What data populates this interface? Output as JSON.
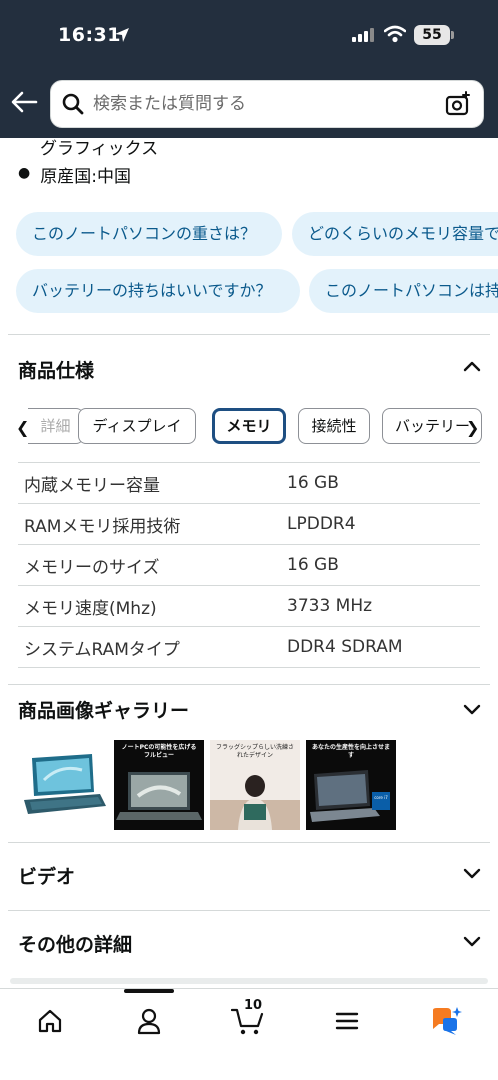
{
  "status_bar": {
    "time": "16:31",
    "battery": "55"
  },
  "search": {
    "placeholder": "検索または質問する"
  },
  "details_tail": {
    "continuation": "グラフィックス",
    "bullet": "原産国:中国"
  },
  "question_chips": [
    "このノートパソコンの重さは？",
    "どのくらいのメモリ容量で",
    "バッテリーの持ちはいいですか？",
    "このノートパソコンは持"
  ],
  "specs": {
    "title": "商品仕様",
    "tabs": [
      "詳細",
      "ディスプレイ",
      "メモリ",
      "接続性",
      "バッテリー"
    ],
    "active_tab": "メモリ",
    "rows": [
      {
        "key": "内蔵メモリー容量",
        "value": "16 GB"
      },
      {
        "key": "RAMメモリ採用技術",
        "value": "LPDDR4"
      },
      {
        "key": "メモリーのサイズ",
        "value": "16 GB"
      },
      {
        "key": "メモリ速度(Mhz)",
        "value": "3733 MHz"
      },
      {
        "key": "システムRAMタイプ",
        "value": "DDR4 SDRAM"
      }
    ]
  },
  "gallery": {
    "title": "商品画像ギャラリー",
    "thumb2_caption": "ノートPCの可能性を広げるフルビュー",
    "thumb3_caption": "フラッグシップらしい洗練されたデザイン",
    "thumb4_caption": "あなたの生産性を向上させます",
    "thumb4_chip": "core i7"
  },
  "video": {
    "title": "ビデオ"
  },
  "other": {
    "title": "その他の詳細"
  },
  "bottom_nav": {
    "cart_count": "10"
  },
  "colors": {
    "header_bg": "#232f3e",
    "chip_bg": "#e3f2fb",
    "chip_text": "#0b5a8c",
    "active_tab_border": "#1e4f82"
  }
}
